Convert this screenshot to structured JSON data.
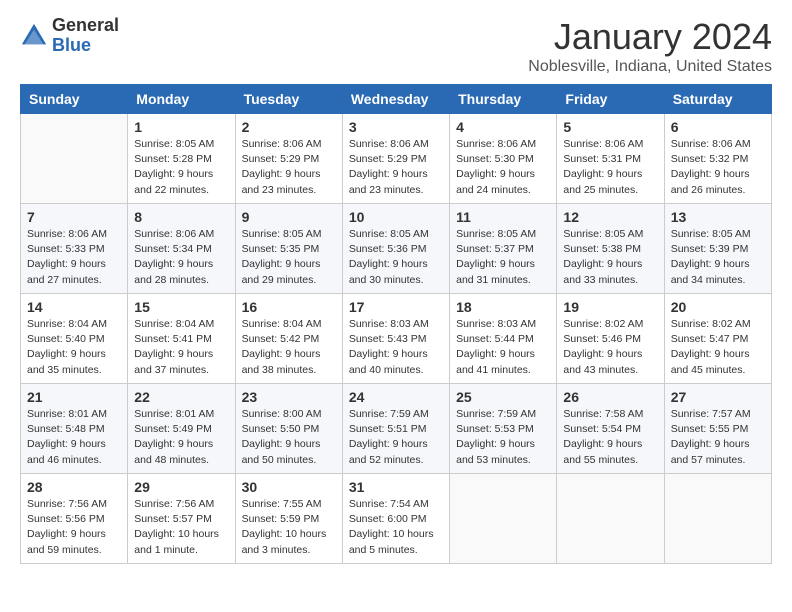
{
  "logo": {
    "general": "General",
    "blue": "Blue"
  },
  "title": "January 2024",
  "subtitle": "Noblesville, Indiana, United States",
  "headers": [
    "Sunday",
    "Monday",
    "Tuesday",
    "Wednesday",
    "Thursday",
    "Friday",
    "Saturday"
  ],
  "weeks": [
    [
      {
        "num": "",
        "sunrise": "",
        "sunset": "",
        "daylight": ""
      },
      {
        "num": "1",
        "sunrise": "Sunrise: 8:05 AM",
        "sunset": "Sunset: 5:28 PM",
        "daylight": "Daylight: 9 hours and 22 minutes."
      },
      {
        "num": "2",
        "sunrise": "Sunrise: 8:06 AM",
        "sunset": "Sunset: 5:29 PM",
        "daylight": "Daylight: 9 hours and 23 minutes."
      },
      {
        "num": "3",
        "sunrise": "Sunrise: 8:06 AM",
        "sunset": "Sunset: 5:29 PM",
        "daylight": "Daylight: 9 hours and 23 minutes."
      },
      {
        "num": "4",
        "sunrise": "Sunrise: 8:06 AM",
        "sunset": "Sunset: 5:30 PM",
        "daylight": "Daylight: 9 hours and 24 minutes."
      },
      {
        "num": "5",
        "sunrise": "Sunrise: 8:06 AM",
        "sunset": "Sunset: 5:31 PM",
        "daylight": "Daylight: 9 hours and 25 minutes."
      },
      {
        "num": "6",
        "sunrise": "Sunrise: 8:06 AM",
        "sunset": "Sunset: 5:32 PM",
        "daylight": "Daylight: 9 hours and 26 minutes."
      }
    ],
    [
      {
        "num": "7",
        "sunrise": "Sunrise: 8:06 AM",
        "sunset": "Sunset: 5:33 PM",
        "daylight": "Daylight: 9 hours and 27 minutes."
      },
      {
        "num": "8",
        "sunrise": "Sunrise: 8:06 AM",
        "sunset": "Sunset: 5:34 PM",
        "daylight": "Daylight: 9 hours and 28 minutes."
      },
      {
        "num": "9",
        "sunrise": "Sunrise: 8:05 AM",
        "sunset": "Sunset: 5:35 PM",
        "daylight": "Daylight: 9 hours and 29 minutes."
      },
      {
        "num": "10",
        "sunrise": "Sunrise: 8:05 AM",
        "sunset": "Sunset: 5:36 PM",
        "daylight": "Daylight: 9 hours and 30 minutes."
      },
      {
        "num": "11",
        "sunrise": "Sunrise: 8:05 AM",
        "sunset": "Sunset: 5:37 PM",
        "daylight": "Daylight: 9 hours and 31 minutes."
      },
      {
        "num": "12",
        "sunrise": "Sunrise: 8:05 AM",
        "sunset": "Sunset: 5:38 PM",
        "daylight": "Daylight: 9 hours and 33 minutes."
      },
      {
        "num": "13",
        "sunrise": "Sunrise: 8:05 AM",
        "sunset": "Sunset: 5:39 PM",
        "daylight": "Daylight: 9 hours and 34 minutes."
      }
    ],
    [
      {
        "num": "14",
        "sunrise": "Sunrise: 8:04 AM",
        "sunset": "Sunset: 5:40 PM",
        "daylight": "Daylight: 9 hours and 35 minutes."
      },
      {
        "num": "15",
        "sunrise": "Sunrise: 8:04 AM",
        "sunset": "Sunset: 5:41 PM",
        "daylight": "Daylight: 9 hours and 37 minutes."
      },
      {
        "num": "16",
        "sunrise": "Sunrise: 8:04 AM",
        "sunset": "Sunset: 5:42 PM",
        "daylight": "Daylight: 9 hours and 38 minutes."
      },
      {
        "num": "17",
        "sunrise": "Sunrise: 8:03 AM",
        "sunset": "Sunset: 5:43 PM",
        "daylight": "Daylight: 9 hours and 40 minutes."
      },
      {
        "num": "18",
        "sunrise": "Sunrise: 8:03 AM",
        "sunset": "Sunset: 5:44 PM",
        "daylight": "Daylight: 9 hours and 41 minutes."
      },
      {
        "num": "19",
        "sunrise": "Sunrise: 8:02 AM",
        "sunset": "Sunset: 5:46 PM",
        "daylight": "Daylight: 9 hours and 43 minutes."
      },
      {
        "num": "20",
        "sunrise": "Sunrise: 8:02 AM",
        "sunset": "Sunset: 5:47 PM",
        "daylight": "Daylight: 9 hours and 45 minutes."
      }
    ],
    [
      {
        "num": "21",
        "sunrise": "Sunrise: 8:01 AM",
        "sunset": "Sunset: 5:48 PM",
        "daylight": "Daylight: 9 hours and 46 minutes."
      },
      {
        "num": "22",
        "sunrise": "Sunrise: 8:01 AM",
        "sunset": "Sunset: 5:49 PM",
        "daylight": "Daylight: 9 hours and 48 minutes."
      },
      {
        "num": "23",
        "sunrise": "Sunrise: 8:00 AM",
        "sunset": "Sunset: 5:50 PM",
        "daylight": "Daylight: 9 hours and 50 minutes."
      },
      {
        "num": "24",
        "sunrise": "Sunrise: 7:59 AM",
        "sunset": "Sunset: 5:51 PM",
        "daylight": "Daylight: 9 hours and 52 minutes."
      },
      {
        "num": "25",
        "sunrise": "Sunrise: 7:59 AM",
        "sunset": "Sunset: 5:53 PM",
        "daylight": "Daylight: 9 hours and 53 minutes."
      },
      {
        "num": "26",
        "sunrise": "Sunrise: 7:58 AM",
        "sunset": "Sunset: 5:54 PM",
        "daylight": "Daylight: 9 hours and 55 minutes."
      },
      {
        "num": "27",
        "sunrise": "Sunrise: 7:57 AM",
        "sunset": "Sunset: 5:55 PM",
        "daylight": "Daylight: 9 hours and 57 minutes."
      }
    ],
    [
      {
        "num": "28",
        "sunrise": "Sunrise: 7:56 AM",
        "sunset": "Sunset: 5:56 PM",
        "daylight": "Daylight: 9 hours and 59 minutes."
      },
      {
        "num": "29",
        "sunrise": "Sunrise: 7:56 AM",
        "sunset": "Sunset: 5:57 PM",
        "daylight": "Daylight: 10 hours and 1 minute."
      },
      {
        "num": "30",
        "sunrise": "Sunrise: 7:55 AM",
        "sunset": "Sunset: 5:59 PM",
        "daylight": "Daylight: 10 hours and 3 minutes."
      },
      {
        "num": "31",
        "sunrise": "Sunrise: 7:54 AM",
        "sunset": "Sunset: 6:00 PM",
        "daylight": "Daylight: 10 hours and 5 minutes."
      },
      {
        "num": "",
        "sunrise": "",
        "sunset": "",
        "daylight": ""
      },
      {
        "num": "",
        "sunrise": "",
        "sunset": "",
        "daylight": ""
      },
      {
        "num": "",
        "sunrise": "",
        "sunset": "",
        "daylight": ""
      }
    ]
  ]
}
